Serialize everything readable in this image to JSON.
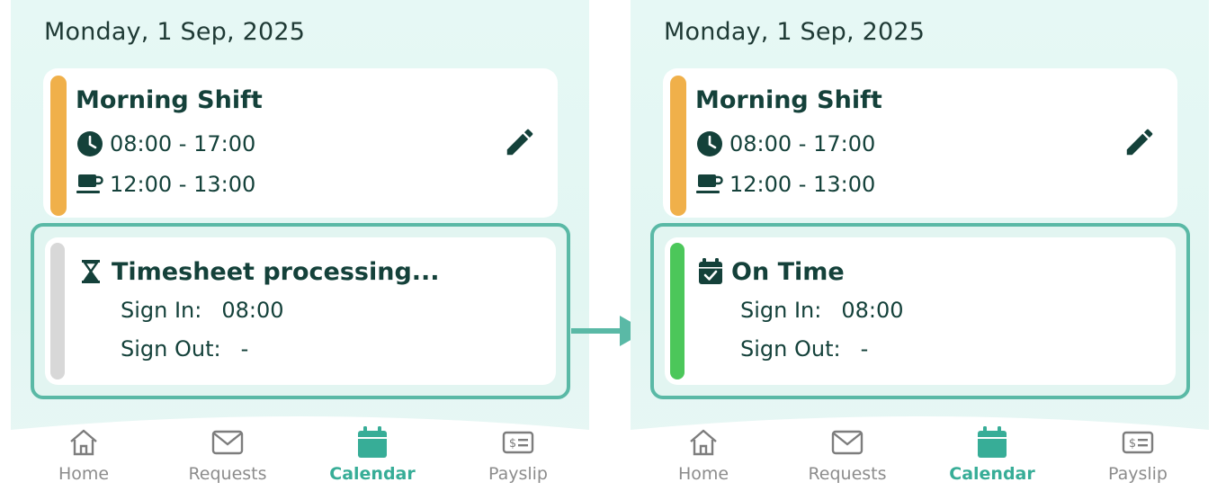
{
  "before": {
    "date": "Monday, 1 Sep, 2025",
    "shift": {
      "title": "Morning Shift",
      "time": "08:00 - 17:00",
      "break": "12:00 - 13:00",
      "accent_color": "#f0b04a"
    },
    "timesheet": {
      "status": "Timesheet processing...",
      "status_icon": "hourglass-icon",
      "accent_color": "#d8d8d8",
      "sign_in_label": "Sign In:",
      "sign_in_value": "08:00",
      "sign_out_label": "Sign Out:",
      "sign_out_value": "-"
    }
  },
  "after": {
    "date": "Monday, 1 Sep, 2025",
    "shift": {
      "title": "Morning Shift",
      "time": "08:00 - 17:00",
      "break": "12:00 - 13:00",
      "accent_color": "#f0b04a"
    },
    "timesheet": {
      "status": "On Time",
      "status_icon": "calendar-check-icon",
      "accent_color": "#4cc75a",
      "sign_in_label": "Sign In:",
      "sign_in_value": "08:00",
      "sign_out_label": "Sign Out:",
      "sign_out_value": "-"
    }
  },
  "nav": {
    "items": [
      {
        "label": "Home",
        "icon": "home-icon"
      },
      {
        "label": "Requests",
        "icon": "envelope-icon"
      },
      {
        "label": "Calendar",
        "icon": "calendar-icon",
        "active": true
      },
      {
        "label": "Payslip",
        "icon": "payslip-icon"
      }
    ]
  },
  "colors": {
    "highlight": "#5ab9a6",
    "active_nav": "#37ad97",
    "text": "#14413a"
  }
}
